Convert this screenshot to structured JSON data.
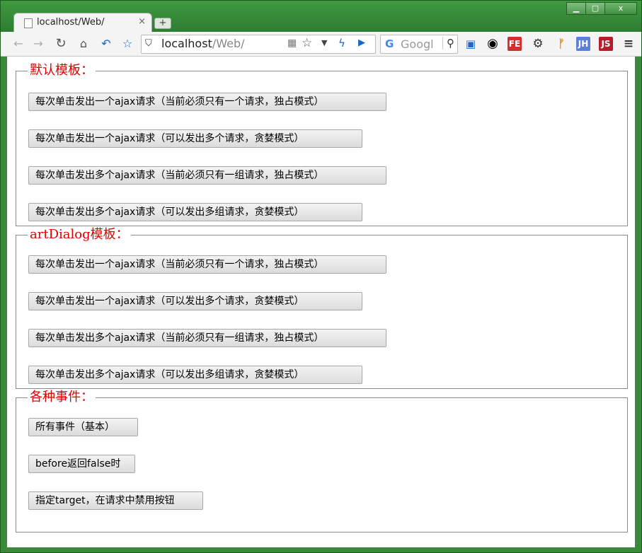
{
  "browser": {
    "tab_title": "localhost/Web/",
    "url_host": "localhost",
    "url_path": "/Web/",
    "search_placeholder": "Googl",
    "window_controls": {
      "minimize": "▁",
      "maximize": "▢",
      "close": "x"
    },
    "extensions": [
      "plus-grid-icon",
      "circle-icon",
      "fe-icon",
      "gear-icon",
      "branch-icon",
      "jh-icon",
      "js-icon",
      "menu-icon"
    ],
    "ext_labels": {
      "fe": "FE",
      "jh": "JH",
      "js": "JS"
    }
  },
  "sections": [
    {
      "legend": "默认模板：",
      "buttons": [
        "每次单击发出一个ajax请求（当前必须只有一个请求，独占模式）",
        "每次单击发出一个ajax请求（可以发出多个请求，贪婪模式）",
        "每次单击发出多个ajax请求（当前必须只有一组请求，独占模式）",
        "每次单击发出多个ajax请求（可以发出多组请求，贪婪模式）"
      ]
    },
    {
      "legend": "artDialog模板：",
      "buttons": [
        "每次单击发出一个ajax请求（当前必须只有一个请求，独占模式）",
        "每次单击发出一个ajax请求（可以发出多个请求，贪婪模式）",
        "每次单击发出多个ajax请求（当前必须只有一组请求，独占模式）",
        "每次单击发出多个ajax请求（可以发出多组请求，贪婪模式）"
      ]
    },
    {
      "legend": "各种事件：",
      "buttons": [
        "所有事件（基本）",
        "before返回false时",
        "指定target，在请求中禁用按钮"
      ]
    }
  ]
}
